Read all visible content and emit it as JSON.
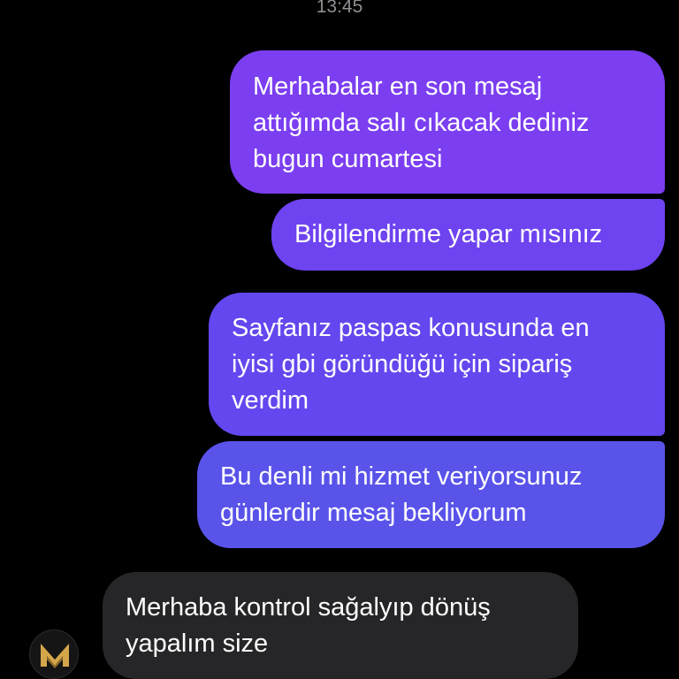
{
  "chat": {
    "timestamp": "13:45",
    "messages": [
      {
        "direction": "outgoing",
        "text": "Merhabalar en son mesaj\nattığımda salı cıkacak dediniz\nbugun cumartesi"
      },
      {
        "direction": "outgoing",
        "text": "Bilgilendirme yapar mısınız"
      },
      {
        "direction": "outgoing",
        "text": "Sayfanız paspas konusunda en\niyisi gbi göründüğü için sipariş\nverdim"
      },
      {
        "direction": "outgoing",
        "text": "Bu denli mi hizmet veriyorsunuz\ngünlerdir mesaj bekliyorum"
      },
      {
        "direction": "incoming",
        "text": "Merhaba  kontrol sağalyıp dönüş\nyapalım size"
      }
    ],
    "avatar": {
      "icon": "m-logo-icon",
      "color": "#d4a64a"
    }
  }
}
